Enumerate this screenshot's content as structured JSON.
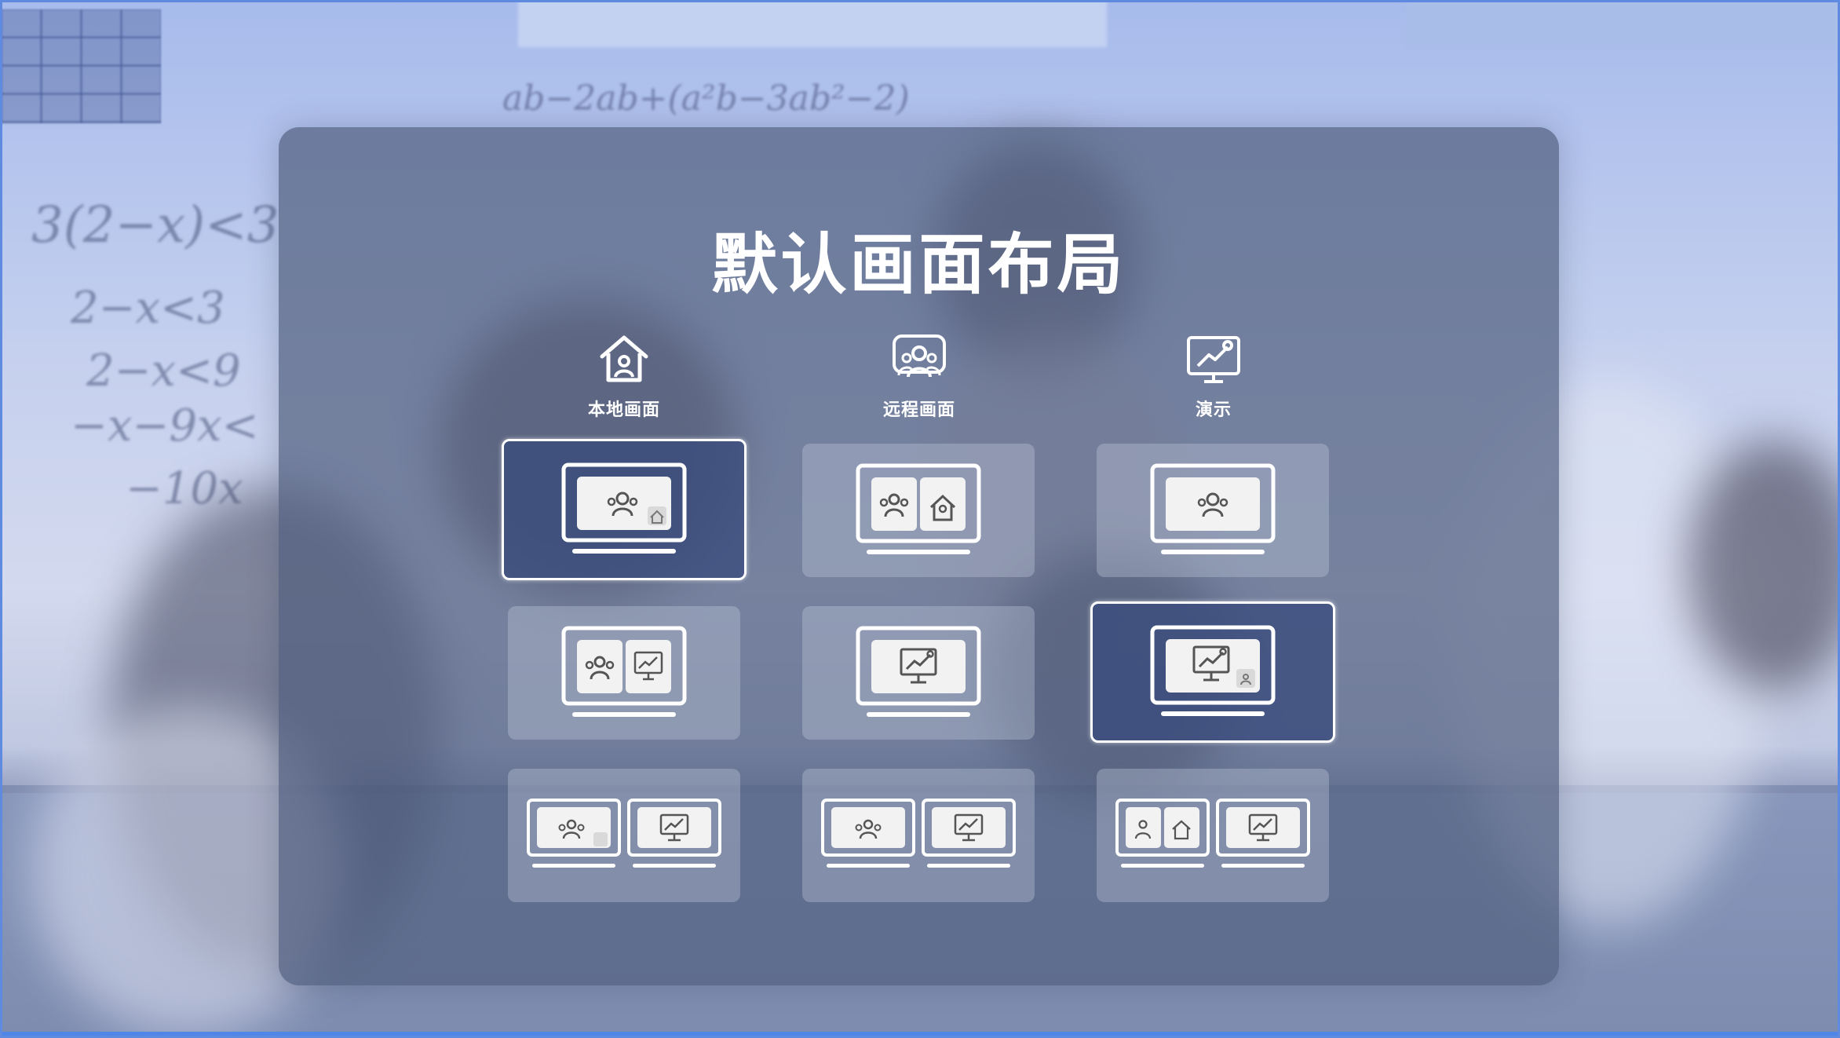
{
  "dialog": {
    "title": "默认画面布局"
  },
  "columns": [
    {
      "key": "local",
      "label": "本地画面",
      "icon": "home-icon"
    },
    {
      "key": "remote",
      "label": "远程画面",
      "icon": "people-icon"
    },
    {
      "key": "present",
      "label": "演示",
      "icon": "presentation-icon"
    }
  ],
  "layouts": [
    {
      "row": 1,
      "col": "local",
      "selected": true,
      "screens": 1,
      "content": "people+home-pip"
    },
    {
      "row": 1,
      "col": "remote",
      "selected": false,
      "screens": 1,
      "content": "people|home split"
    },
    {
      "row": 1,
      "col": "present",
      "selected": false,
      "screens": 1,
      "content": "people"
    },
    {
      "row": 2,
      "col": "local",
      "selected": false,
      "screens": 1,
      "content": "people|presentation split"
    },
    {
      "row": 2,
      "col": "remote",
      "selected": false,
      "screens": 1,
      "content": "presentation"
    },
    {
      "row": 2,
      "col": "present",
      "selected": true,
      "screens": 1,
      "content": "presentation+people-pip"
    },
    {
      "row": 3,
      "col": "local",
      "selected": false,
      "screens": 2,
      "content": "people+home-pip / presentation"
    },
    {
      "row": 3,
      "col": "remote",
      "selected": false,
      "screens": 2,
      "content": "people / presentation"
    },
    {
      "row": 3,
      "col": "present",
      "selected": false,
      "screens": 2,
      "content": "people|home split / presentation"
    }
  ],
  "colors": {
    "panel": "#526080",
    "selected_tile": "#3a4c7d",
    "tile": "#bec6d7",
    "accent_bar": "#4f86e8"
  }
}
